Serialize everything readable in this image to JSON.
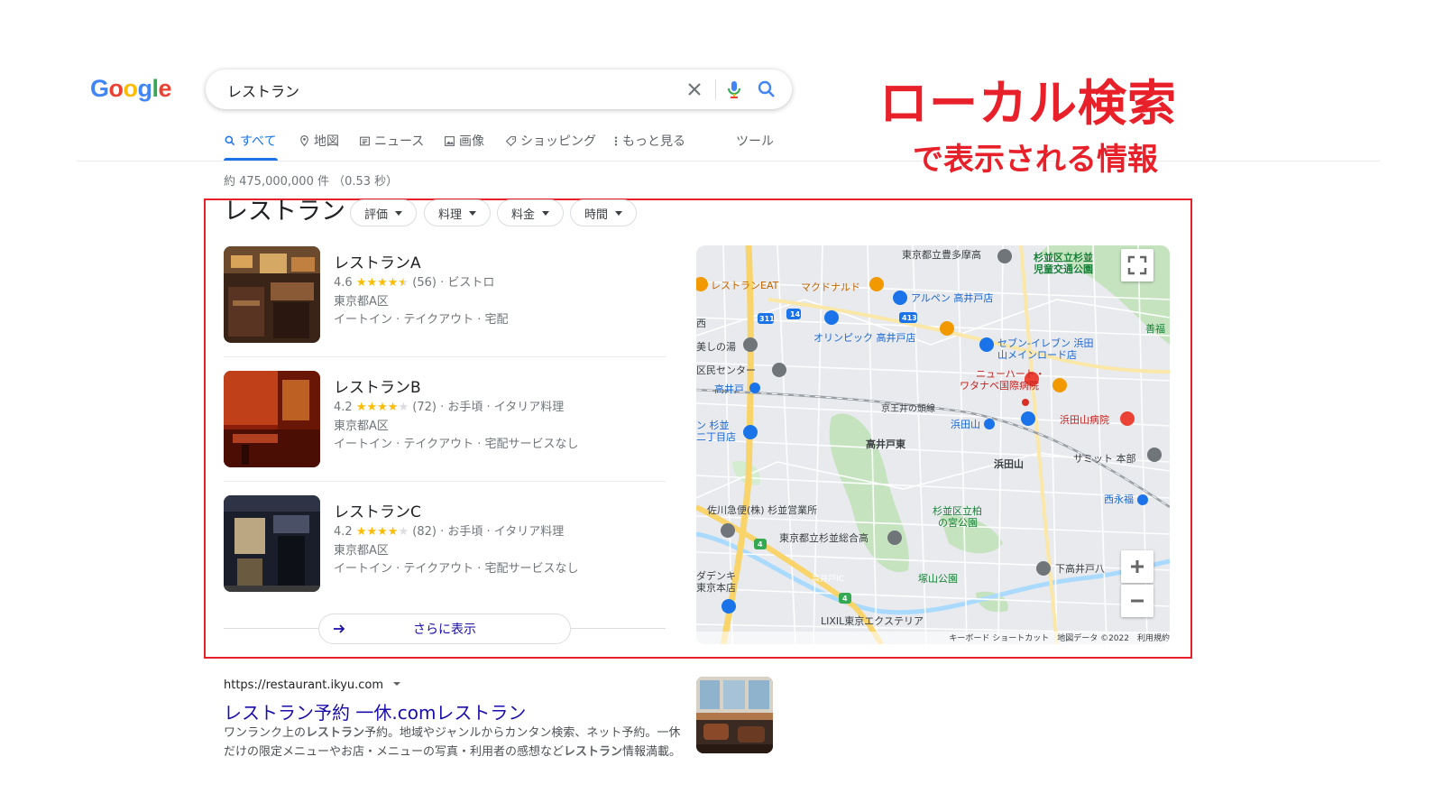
{
  "search": {
    "query": "レストラン"
  },
  "tabs": [
    {
      "label": "すべて",
      "icon": "search-icon"
    },
    {
      "label": "地図",
      "icon": "map-pin-icon"
    },
    {
      "label": "ニュース",
      "icon": "news-icon"
    },
    {
      "label": "画像",
      "icon": "image-icon"
    },
    {
      "label": "ショッピング",
      "icon": "tag-icon"
    },
    {
      "label": "もっと見る",
      "icon": "more-vert-icon"
    },
    {
      "label": "ツール",
      "icon": ""
    }
  ],
  "result_stats": "約 475,000,000 件 （0.53 秒）",
  "annotation": {
    "title": "ローカル検索",
    "subtitle": "で表示される情報",
    "color": "#e8202a"
  },
  "local_pack": {
    "title": "レストラン",
    "filters": [
      "評価",
      "料理",
      "料金",
      "時間"
    ],
    "places": [
      {
        "name": "レストランA",
        "rating": "4.6",
        "stars": 4.5,
        "reviews": "(56)",
        "category": "ビストロ",
        "address": "東京都A区",
        "services": "イートイン · テイクアウト · 宅配"
      },
      {
        "name": "レストランB",
        "rating": "4.2",
        "stars": 4,
        "reviews": "(72)",
        "category": "お手頃 · イタリア料理",
        "address": "東京都A区",
        "services": "イートイン · テイクアウト · 宅配サービスなし"
      },
      {
        "name": "レストランC",
        "rating": "4.2",
        "stars": 4,
        "reviews": "(82)",
        "category": "お手頃 · イタリア料理",
        "address": "東京都A区",
        "services": "イートイン · テイクアウト · 宅配サービスなし"
      }
    ],
    "more_label": "さらに表示"
  },
  "map": {
    "labels": [
      "東京都立豊多摩高",
      "杉並区立杉並",
      "児童交通公園",
      "レストランEAT",
      "マクドナルド",
      "アルペン 高井戸店",
      "西",
      "オリンピック 高井戸店",
      "セブン-イレブン 浜田",
      "山メインロード店",
      "美しの湯",
      "区民センター",
      "ニューハート・",
      "ワタナベ国際病院",
      "高井戸",
      "京王井の頭線",
      "浜田山",
      "浜田山病院",
      "ン 杉並",
      "二丁目店",
      "高井戸東",
      "浜田山",
      "サミット 本部",
      "佐川急便(株) 杉並営業所",
      "杉並区立柏",
      "の宮公園",
      "西永福",
      "東京都立杉並総合高",
      "ダデンキ",
      "東京本店",
      "高井戸IC",
      "塚山公園",
      "下高井戸八",
      "LIXIL東京エクステリア",
      "善福"
    ],
    "route_numbers": [
      "311",
      "14",
      "413",
      "4",
      "4"
    ],
    "attribution": "キーボード ショートカット　地図データ ©2022　利用規約"
  },
  "organic": {
    "url": "https://restaurant.ikyu.com",
    "title": "レストラン予約 一休.comレストラン",
    "snippet_1": "ワンランク上の",
    "snippet_b1": "レストラン",
    "snippet_2": "予約。地域やジャンルからカンタン検索、ネット予約。一休だけの限定メニューやお店・メニューの写真・利用者の感想など",
    "snippet_b2": "レストラン",
    "snippet_3": "情報満載。"
  },
  "logo_text": "Google"
}
